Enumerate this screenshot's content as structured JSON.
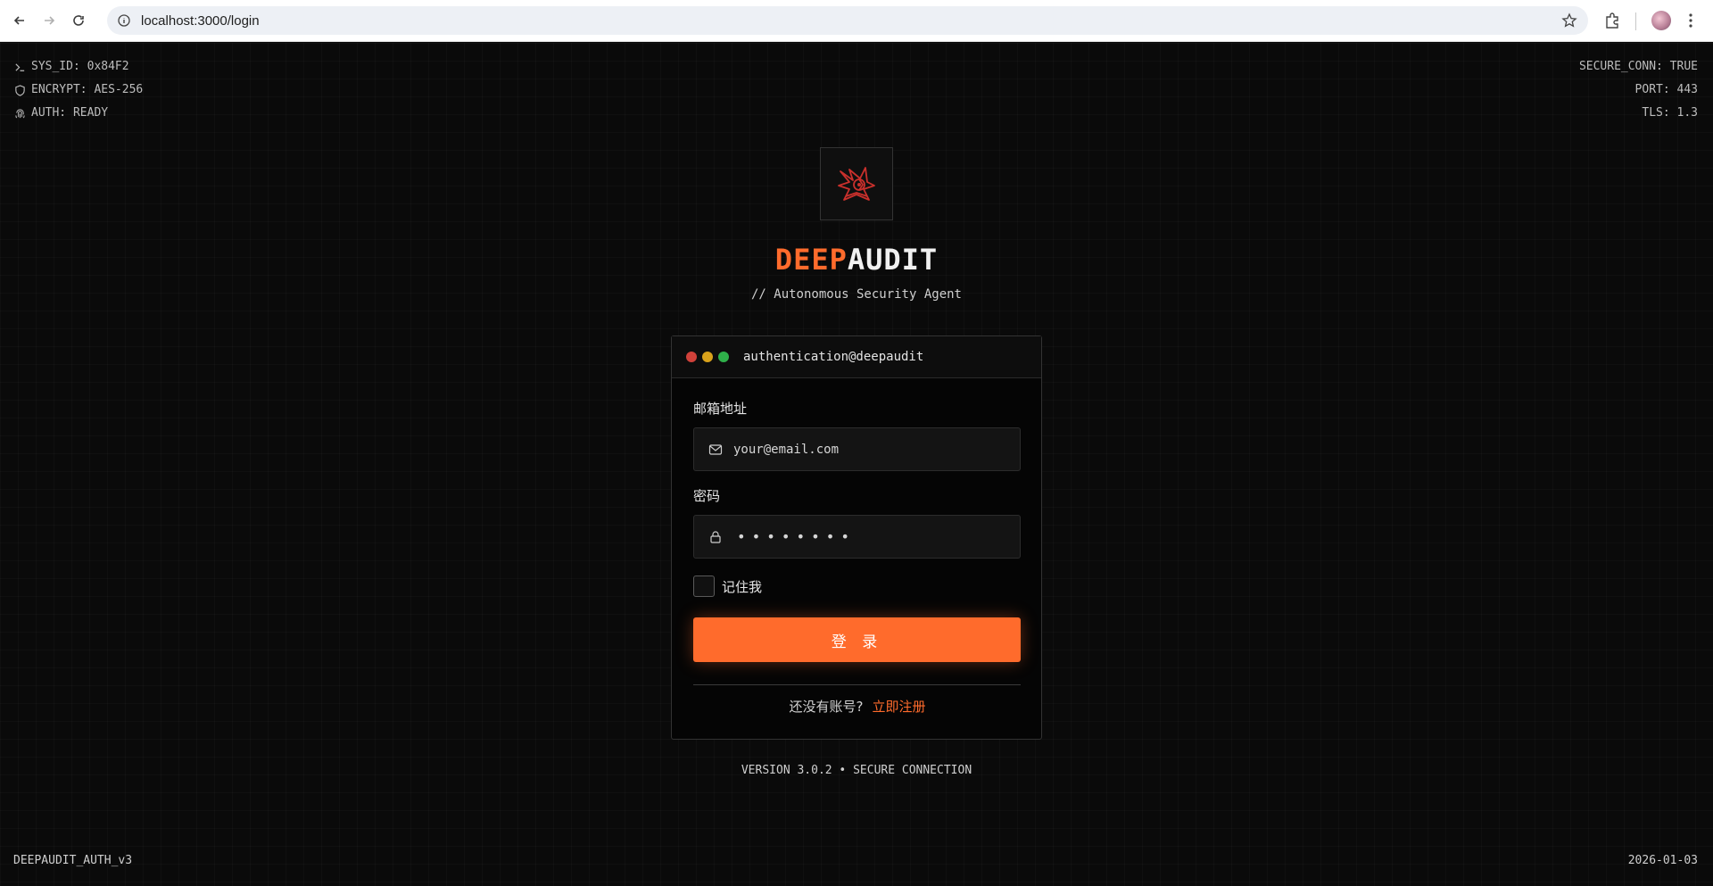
{
  "browser": {
    "url": "localhost:3000/login"
  },
  "sys_left": [
    {
      "icon": "terminal-icon",
      "text": "SYS_ID: 0x84F2"
    },
    {
      "icon": "shield-icon",
      "text": "ENCRYPT: AES-256"
    },
    {
      "icon": "fingerprint-icon",
      "text": "AUTH: READY"
    }
  ],
  "sys_right": [
    "SECURE_CONN: TRUE",
    "PORT: 443",
    "TLS: 1.3"
  ],
  "brand": {
    "deep": "DEEP",
    "audit": "AUDIT",
    "tagline": "// Autonomous Security Agent",
    "accent_color": "#ff6b2c"
  },
  "card": {
    "title": "authentication@deepaudit",
    "email_label": "邮箱地址",
    "email_value": "your@email.com",
    "password_label": "密码",
    "password_mask": "••••••••",
    "remember_label": "记住我",
    "login_label": "登 录",
    "no_account": "还没有账号?",
    "register_link": "立即注册"
  },
  "footer": {
    "center": "VERSION 3.0.2 • SECURE CONNECTION",
    "left": "DEEPAUDIT_AUTH_v3",
    "right": "2026-01-03"
  }
}
